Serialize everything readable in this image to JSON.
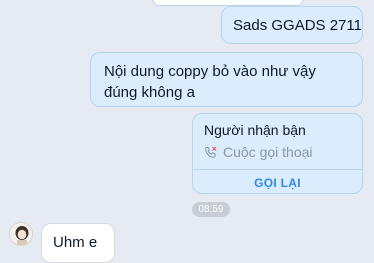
{
  "messages": {
    "out1": "Sads GGADS 2711",
    "out2": "Nội dung coppy bỏ vào như vậy đúng không a"
  },
  "call_card": {
    "title": "Người nhận bận",
    "subtitle": "Cuộc gọi thoại",
    "action": "GỌI LẠI"
  },
  "timestamp": "08:59",
  "incoming": {
    "text": "Uhm e"
  },
  "icons": {
    "call": "missed-call-icon",
    "avatar": "user-avatar"
  },
  "colors": {
    "background": "#e6ebf3",
    "outgoing_bubble": "#dbecfd",
    "incoming_bubble": "#ffffff",
    "accent": "#2f8ae8"
  }
}
